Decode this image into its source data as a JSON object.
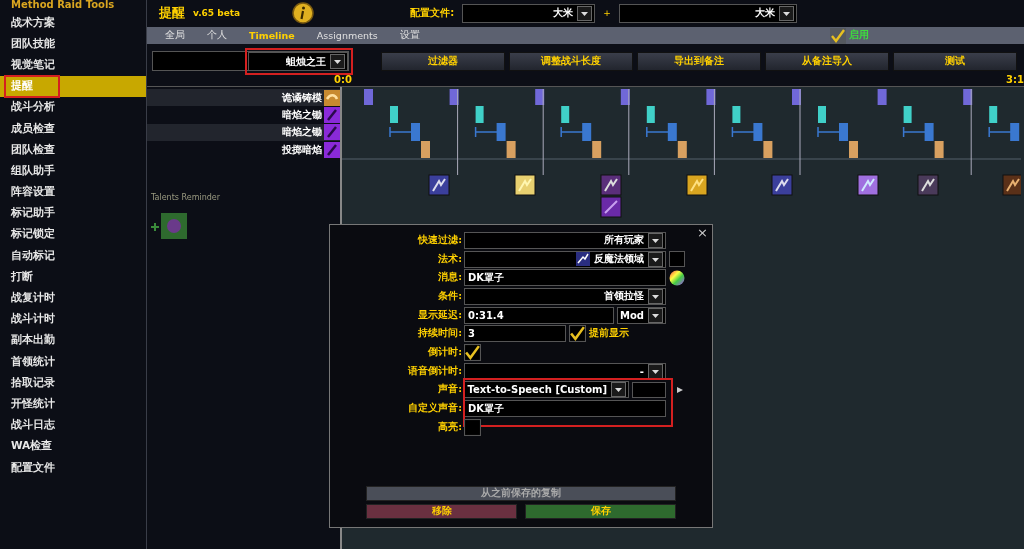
{
  "sidebar": {
    "title": "Method Raid Tools",
    "items": [
      {
        "label": "战术方案",
        "selected": false,
        "highlighted": false
      },
      {
        "label": "团队技能",
        "selected": false,
        "highlighted": false
      },
      {
        "label": "视觉笔记",
        "selected": false,
        "highlighted": false
      },
      {
        "label": "提醒",
        "selected": true,
        "highlighted": true
      },
      {
        "label": "战斗分析",
        "selected": false,
        "highlighted": false
      },
      {
        "label": "成员检查",
        "selected": false,
        "highlighted": false
      },
      {
        "label": "团队检查",
        "selected": false,
        "highlighted": false
      },
      {
        "label": "组队助手",
        "selected": false,
        "highlighted": false
      },
      {
        "label": "阵容设置",
        "selected": false,
        "highlighted": false
      },
      {
        "label": "标记助手",
        "selected": false,
        "highlighted": false
      },
      {
        "label": "标记锁定",
        "selected": false,
        "highlighted": false
      },
      {
        "label": "自动标记",
        "selected": false,
        "highlighted": false
      },
      {
        "label": "打断",
        "selected": false,
        "highlighted": false
      },
      {
        "label": "战复计时",
        "selected": false,
        "highlighted": false
      },
      {
        "label": "战斗计时",
        "selected": false,
        "highlighted": false
      },
      {
        "label": "副本出勤",
        "selected": false,
        "highlighted": false
      },
      {
        "label": "首领统计",
        "selected": false,
        "highlighted": false
      },
      {
        "label": "拾取记录",
        "selected": false,
        "highlighted": false
      },
      {
        "label": "开怪统计",
        "selected": false,
        "highlighted": false
      },
      {
        "label": "战斗日志",
        "selected": false,
        "highlighted": false
      },
      {
        "label": "WA检查",
        "selected": false,
        "highlighted": false
      },
      {
        "label": "配置文件",
        "selected": false,
        "highlighted": false
      }
    ]
  },
  "header": {
    "title": "提醒",
    "version": "v.65 beta",
    "profile_label": "配置文件:",
    "profile": "大米",
    "plus": "+",
    "profile_2": "大米"
  },
  "tabs": [
    {
      "label": "全局",
      "selected": false
    },
    {
      "label": "个人",
      "selected": false
    },
    {
      "label": "Timeline",
      "selected": true
    },
    {
      "label": "Assignments",
      "selected": false
    },
    {
      "label": "设置",
      "selected": false
    }
  ],
  "enable": {
    "label": "启用",
    "checked": true
  },
  "boss_select": {
    "value": "蛆烛之王",
    "highlighted": true
  },
  "buttons": [
    "过滤器",
    "调整战斗长度",
    "导出到备注",
    "从备注导入",
    "测试"
  ],
  "timeline": {
    "start": "0:0",
    "end": "3:1",
    "spells": [
      "诡谲铸模",
      "暗焰之锄",
      "暗焰之锄",
      "投掷暗焰"
    ],
    "ghost_label": "Talents Reminder"
  },
  "dialog": {
    "close": "×",
    "fields": [
      {
        "kind": "dropdown",
        "label": "快速过滤:",
        "value": "所有玩家",
        "highlighted": false
      },
      {
        "kind": "spell",
        "label": "法术:",
        "value": "反魔法领域",
        "highlighted": false
      },
      {
        "kind": "message",
        "label": "消息:",
        "value": "DK罩子",
        "highlighted": false
      },
      {
        "kind": "dropdown",
        "label": "条件:",
        "value": "首领拉怪",
        "highlighted": false
      },
      {
        "kind": "delay",
        "label": "显示延迟:",
        "value": "0:31.4",
        "mod": "Mod",
        "highlighted": false
      },
      {
        "kind": "duration",
        "label": "持续时间:",
        "value": "3",
        "checked": true,
        "check_label": "提前显示",
        "highlighted": false
      },
      {
        "kind": "checkbox",
        "label": "倒计时:",
        "checked": true,
        "highlighted": false
      },
      {
        "kind": "dropdown",
        "label": "语音倒计时:",
        "value": "-",
        "highlighted": false
      },
      {
        "kind": "sound",
        "label": "声音:",
        "value": "Text-to-Speech [Custom]",
        "highlighted": true
      },
      {
        "kind": "text",
        "label": "自定义声音:",
        "value": "DK罩子",
        "highlighted": true
      },
      {
        "kind": "checkbox",
        "label": "高亮:",
        "checked": false,
        "highlighted": false
      }
    ],
    "copy_button": "从之前保存的复制",
    "remove_button": "移除",
    "save_button": "保存"
  }
}
